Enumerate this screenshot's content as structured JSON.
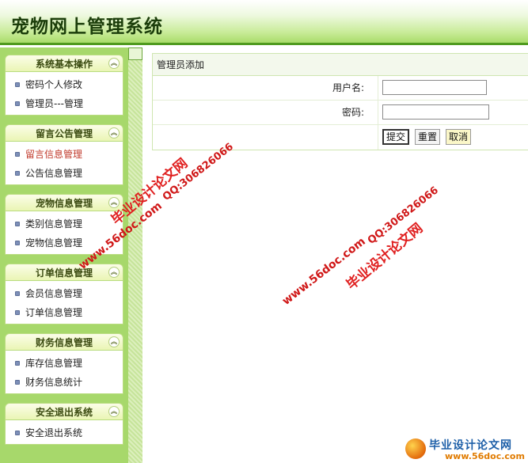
{
  "header": {
    "title": "宠物网上管理系统"
  },
  "sidebar": {
    "collapse_glyph": "︽",
    "bullet_color": "#7d8fb8",
    "groups": [
      {
        "title": "系统基本操作",
        "items": [
          "密码个人修改",
          "管理员---管理"
        ]
      },
      {
        "title": "留言公告管理",
        "items": [
          "留言信息管理",
          "公告信息管理"
        ]
      },
      {
        "title": "宠物信息管理",
        "items": [
          "类别信息管理",
          "宠物信息管理"
        ]
      },
      {
        "title": "订单信息管理",
        "items": [
          "会员信息管理",
          "订单信息管理"
        ]
      },
      {
        "title": "财务信息管理",
        "items": [
          "库存信息管理",
          "财务信息统计"
        ]
      },
      {
        "title": "安全退出系统",
        "items": [
          "安全退出系统"
        ]
      }
    ]
  },
  "form": {
    "title": "管理员添加",
    "username_label": "用户名:",
    "username_value": "",
    "password_label": "密码:",
    "password_value": "",
    "submit_label": "提交",
    "reset_label": "重置",
    "cancel_label": "取消"
  },
  "watermarks": {
    "brand": "毕业设计论文网",
    "url": "www.56doc.com",
    "qq": "QQ:306826066"
  },
  "logo": {
    "text": "毕业设计论文网",
    "url": "www.56doc.com"
  },
  "colors": {
    "header_border": "#4f9a1e",
    "sidebar_bg": "#a7d86b",
    "watermark": "#e02020"
  }
}
